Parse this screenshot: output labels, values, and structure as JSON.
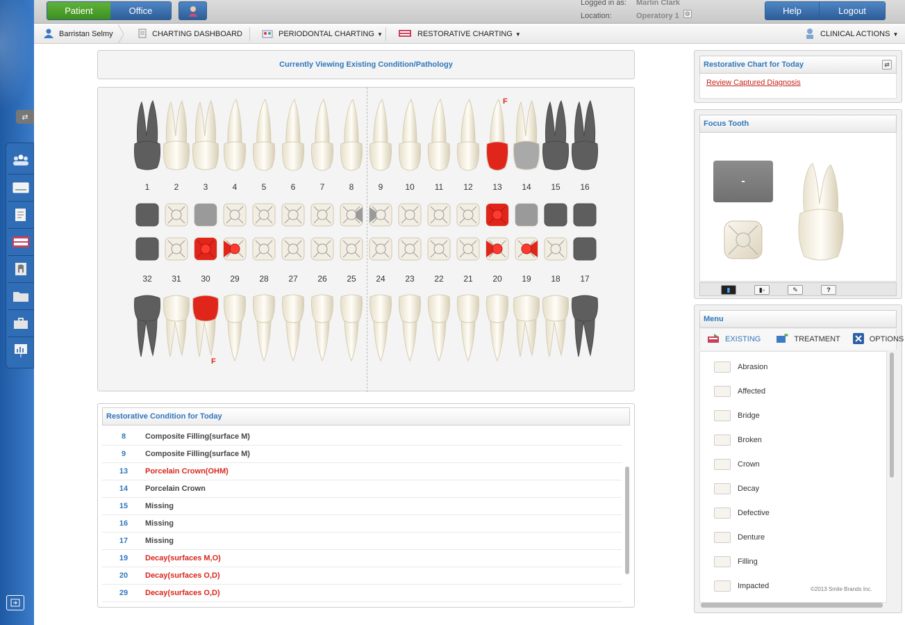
{
  "header": {
    "patient_label": "Patient",
    "office_label": "Office",
    "logged_in_label": "Logged in as:",
    "logged_in_value": "Marlin Clark",
    "location_label": "Location:",
    "location_value": "Operatory 1",
    "help_label": "Help",
    "logout_label": "Logout"
  },
  "nav": {
    "patient_name": "Barristan Selmy",
    "charting_dashboard": "CHARTING DASHBOARD",
    "periodontal_charting": "PERIODONTAL CHARTING",
    "restorative_charting": "RESTORATIVE CHARTING",
    "clinical_actions": "CLINICAL ACTIONS"
  },
  "main": {
    "viewing_label": "Currently Viewing Existing Condition/Pathology",
    "upper_numbers": [
      "1",
      "2",
      "3",
      "4",
      "5",
      "6",
      "7",
      "8",
      "9",
      "10",
      "11",
      "12",
      "13",
      "14",
      "15",
      "16"
    ],
    "lower_numbers": [
      "32",
      "31",
      "30",
      "29",
      "28",
      "27",
      "26",
      "25",
      "24",
      "23",
      "22",
      "21",
      "20",
      "19",
      "18",
      "17"
    ],
    "upper_mark": "F",
    "lower_mark": "F"
  },
  "conditions": {
    "title": "Restorative Condition for Today",
    "rows": [
      {
        "tooth": "8",
        "desc": "Composite Filling(surface M)"
      },
      {
        "tooth": "9",
        "desc": "Composite Filling(surface M)"
      },
      {
        "tooth": "13",
        "desc": "Porcelain Crown(OHM)"
      },
      {
        "tooth": "14",
        "desc": "Porcelain Crown"
      },
      {
        "tooth": "15",
        "desc": "Missing"
      },
      {
        "tooth": "16",
        "desc": "Missing"
      },
      {
        "tooth": "17",
        "desc": "Missing"
      },
      {
        "tooth": "19",
        "desc": "Decay(surfaces M,O)"
      },
      {
        "tooth": "20",
        "desc": "Decay(surfaces O,D)"
      },
      {
        "tooth": "29",
        "desc": "Decay(surfaces O,D)"
      }
    ]
  },
  "right": {
    "restorative_chart_title": "Restorative Chart for Today",
    "review_link": "Review Captured Diagnosis",
    "focus_title": "Focus Tooth",
    "focus_value": "-",
    "focus_help": "?",
    "menu_title": "Menu",
    "tabs": {
      "existing": "EXISTING",
      "treatment": "TREATMENT",
      "options": "OPTIONS"
    },
    "menu_items": [
      "Abrasion",
      "Affected",
      "Bridge",
      "Broken",
      "Crown",
      "Decay",
      "Defective",
      "Denture",
      "Filling",
      "Impacted"
    ],
    "copyright": "©2013 Smile Brands Inc."
  },
  "colors": {
    "accent_blue": "#2f77bd",
    "decay_red": "#e0261b",
    "missing_gray": "#5e5e5e",
    "patient_green": "#4aa02c"
  }
}
